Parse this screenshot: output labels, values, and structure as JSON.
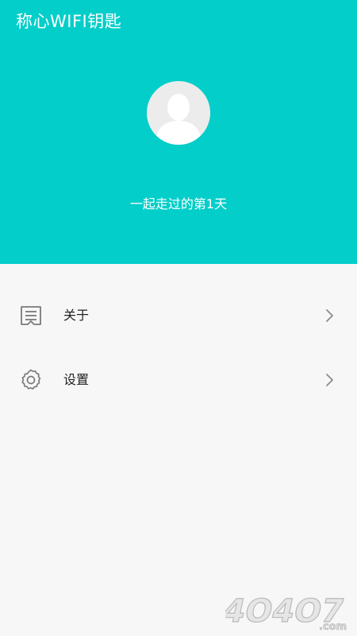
{
  "app": {
    "title": "称心WIFI钥匙"
  },
  "profile": {
    "days_text": "一起走过的第1天"
  },
  "menu": {
    "items": [
      {
        "label": "关于",
        "icon": "document-icon"
      },
      {
        "label": "设置",
        "icon": "gear-icon"
      }
    ]
  },
  "watermark": {
    "text": "4O4O7",
    "suffix": ".com"
  },
  "colors": {
    "header_bg": "#04cec9",
    "page_bg": "#f7f7f7",
    "icon_gray": "#7a7a7a"
  }
}
